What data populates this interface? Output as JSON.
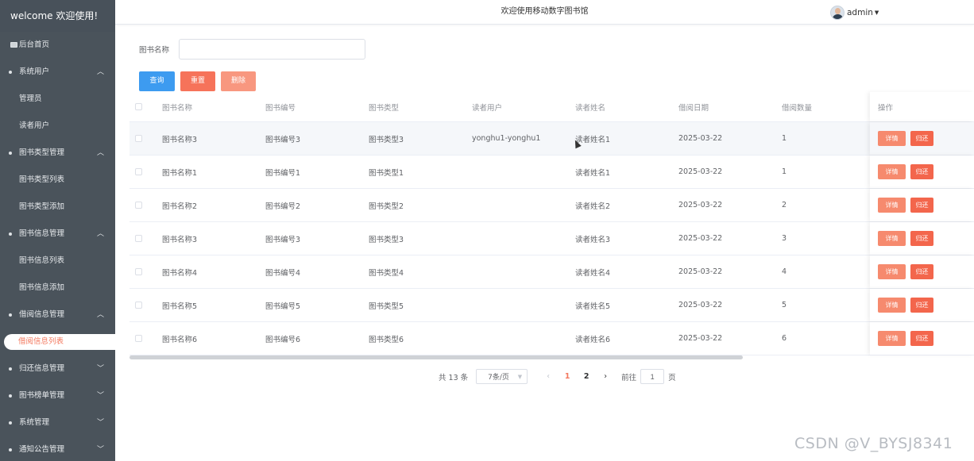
{
  "sidebar": {
    "brand": "welcome 欢迎使用!",
    "home": "后台首页",
    "items": [
      {
        "label": "系统用户",
        "type": "group",
        "expanded": true
      },
      {
        "label": "管理员",
        "type": "sub"
      },
      {
        "label": "读者用户",
        "type": "sub"
      },
      {
        "label": "图书类型管理",
        "type": "group",
        "expanded": true
      },
      {
        "label": "图书类型列表",
        "type": "sub"
      },
      {
        "label": "图书类型添加",
        "type": "sub"
      },
      {
        "label": "图书信息管理",
        "type": "group",
        "expanded": true
      },
      {
        "label": "图书信息列表",
        "type": "sub"
      },
      {
        "label": "图书信息添加",
        "type": "sub"
      },
      {
        "label": "借阅信息管理",
        "type": "group",
        "expanded": true
      },
      {
        "label": "借阅信息列表",
        "type": "sub",
        "active": true
      },
      {
        "label": "归还信息管理",
        "type": "group",
        "expanded": false
      },
      {
        "label": "图书榜单管理",
        "type": "group",
        "expanded": false
      },
      {
        "label": "系统管理",
        "type": "group",
        "expanded": false
      },
      {
        "label": "通知公告管理",
        "type": "group",
        "expanded": false
      }
    ]
  },
  "header": {
    "title": "欢迎使用移动数字图书馆",
    "user": "admin"
  },
  "search": {
    "label": "图书名称",
    "value": "",
    "placeholder": ""
  },
  "buttons": {
    "query": "查询",
    "reset": "重置",
    "delete": "删除"
  },
  "table": {
    "columns": [
      "图书名称",
      "图书编号",
      "图书类型",
      "读者用户",
      "读者姓名",
      "借阅日期",
      "借阅数量",
      "操作"
    ],
    "rows": [
      {
        "name": "图书名称3",
        "code": "图书编号3",
        "type": "图书类型3",
        "user": "yonghu1-yonghu1",
        "reader": "读者姓名1",
        "date": "2025-03-22",
        "qty": "1"
      },
      {
        "name": "图书名称1",
        "code": "图书编号1",
        "type": "图书类型1",
        "user": "",
        "reader": "读者姓名1",
        "date": "2025-03-22",
        "qty": "1"
      },
      {
        "name": "图书名称2",
        "code": "图书编号2",
        "type": "图书类型2",
        "user": "",
        "reader": "读者姓名2",
        "date": "2025-03-22",
        "qty": "2"
      },
      {
        "name": "图书名称3",
        "code": "图书编号3",
        "type": "图书类型3",
        "user": "",
        "reader": "读者姓名3",
        "date": "2025-03-22",
        "qty": "3"
      },
      {
        "name": "图书名称4",
        "code": "图书编号4",
        "type": "图书类型4",
        "user": "",
        "reader": "读者姓名4",
        "date": "2025-03-22",
        "qty": "4"
      },
      {
        "name": "图书名称5",
        "code": "图书编号5",
        "type": "图书类型5",
        "user": "",
        "reader": "读者姓名5",
        "date": "2025-03-22",
        "qty": "5"
      },
      {
        "name": "图书名称6",
        "code": "图书编号6",
        "type": "图书类型6",
        "user": "",
        "reader": "读者姓名6",
        "date": "2025-03-22",
        "qty": "6"
      }
    ],
    "op_detail": "详情",
    "op_return": "归还"
  },
  "pager": {
    "total": "共 13 条",
    "page_size": "7条/页",
    "pages": [
      "1",
      "2"
    ],
    "current": "1",
    "goto_label": "前往",
    "goto_value": "1",
    "goto_suffix": "页"
  },
  "watermark": "CSDN @V_BYSJ8341",
  "colors": {
    "sidebar_bg": "#4a535b",
    "accent": "#f3795f",
    "primary": "#3d9bf0"
  }
}
